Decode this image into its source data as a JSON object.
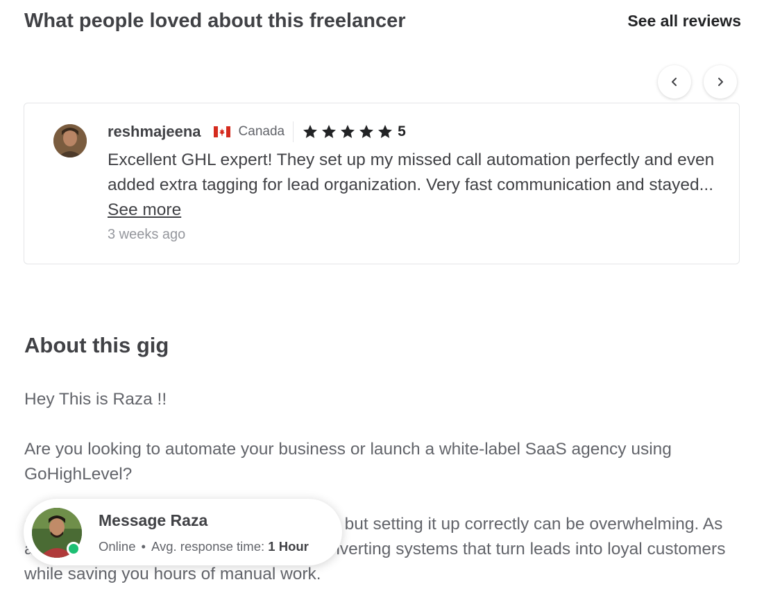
{
  "reviews": {
    "title": "What people loved about this freelancer",
    "see_all_label": "See all reviews",
    "nav": {
      "prev_icon": "chevron-left-icon",
      "next_icon": "chevron-right-icon"
    },
    "card": {
      "reviewer_name": "reshmajeena",
      "country_flag_icon": "canada-flag-icon",
      "country": "Canada",
      "rating_value": "5",
      "stars": 5,
      "text": "Excellent GHL expert! They set up my missed call automation perfectly and even added extra tagging for lead organization. Very fast communication and stayed...",
      "see_more_label": "See more",
      "time_ago": "3 weeks ago"
    }
  },
  "about": {
    "title": "About this gig",
    "paragraphs": [
      "Hey This is Raza !!",
      "Are you looking to automate your business or launch a white-label SaaS agency using GoHighLevel?",
      "GoHighLevel is a powerful tool for growth, but setting it up correctly can be overwhelming. As an expert, I specialize in building high-converting systems that turn leads into loyal customers while saving you hours of manual work."
    ]
  },
  "message": {
    "title": "Message Raza",
    "status": "Online",
    "separator": "•",
    "response_label": "Avg. response time:",
    "response_value": "1 Hour"
  },
  "colors": {
    "text_primary": "#404145",
    "text_secondary": "#62646a",
    "text_muted": "#95979d",
    "online_green": "#1dbf73",
    "border": "#e4e5e7",
    "canada_red": "#d52b1e"
  }
}
